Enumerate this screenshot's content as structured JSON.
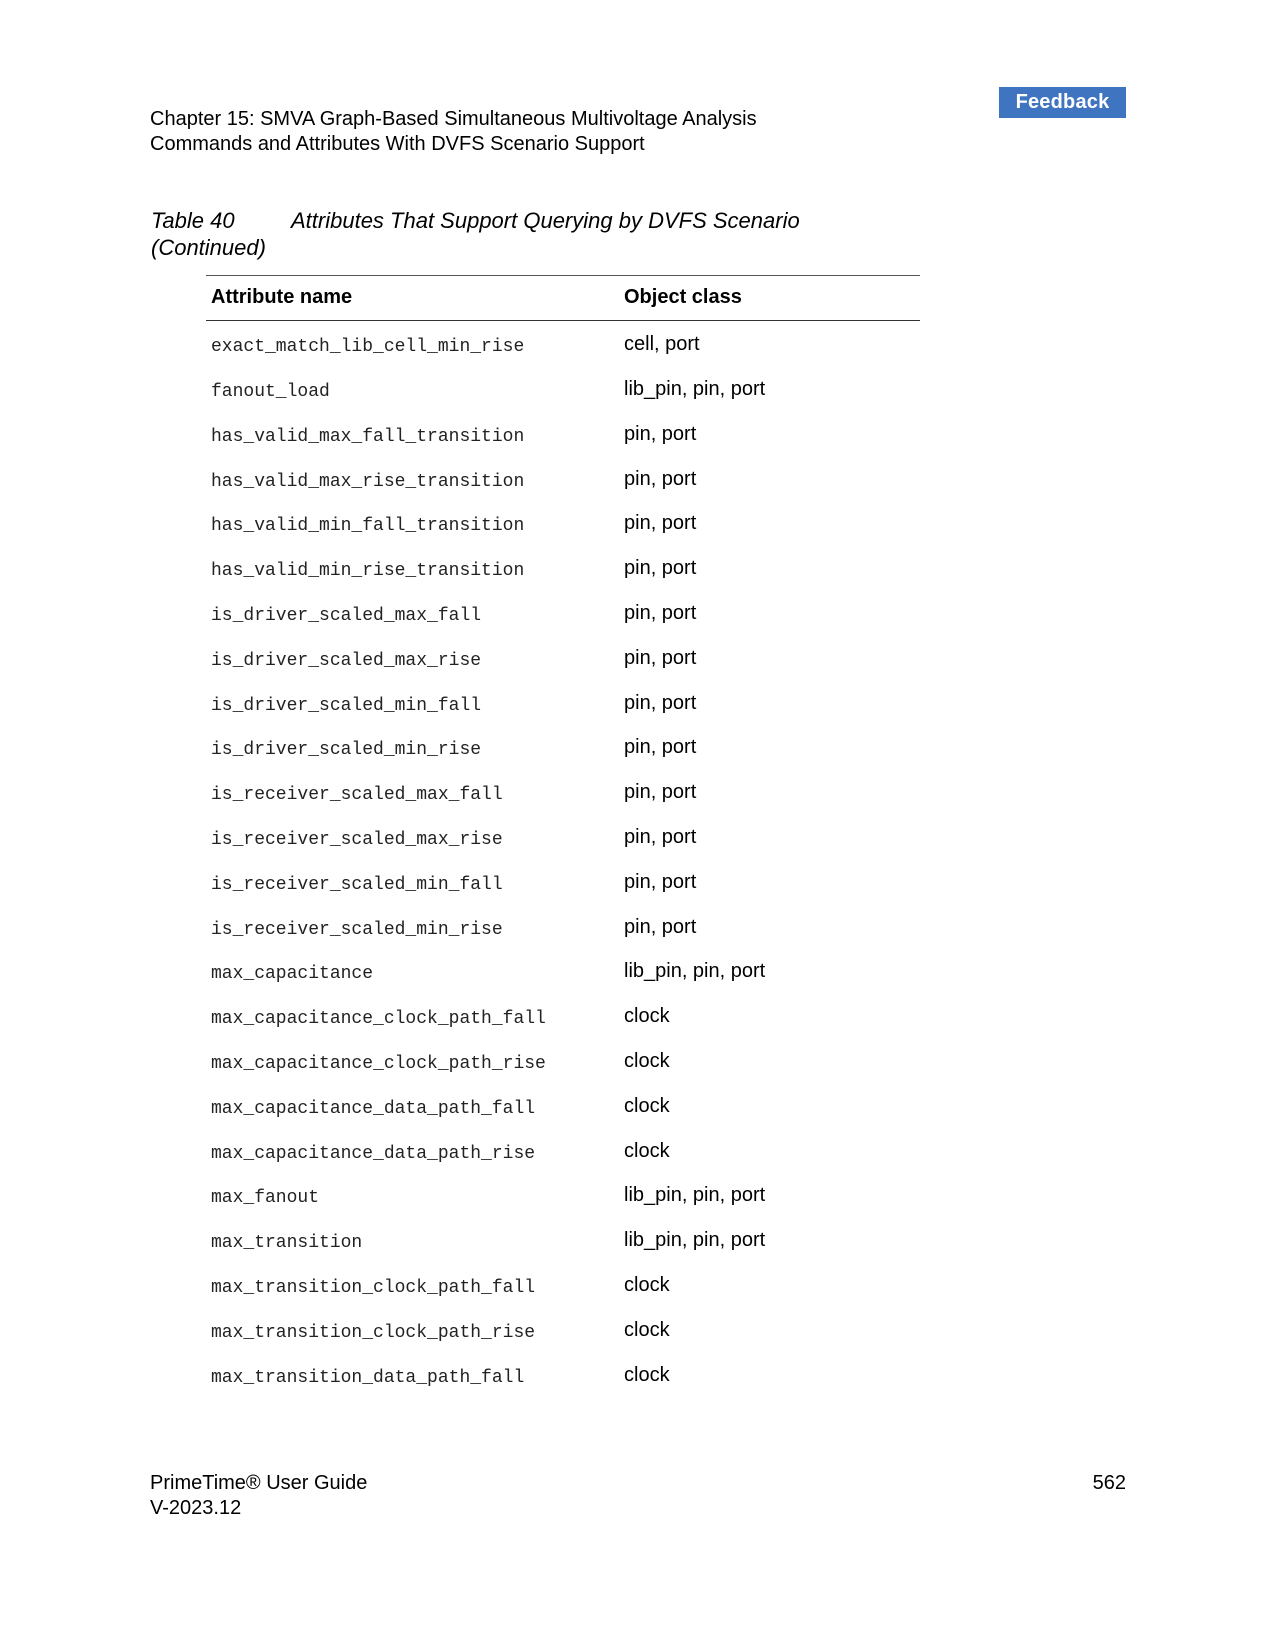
{
  "feedback_label": "Feedback",
  "header": {
    "line1": "Chapter 15: SMVA Graph-Based Simultaneous Multivoltage Analysis",
    "line2": "Commands and Attributes With DVFS Scenario Support"
  },
  "caption": {
    "number": "Table 40",
    "title": "Attributes That Support Querying by DVFS Scenario",
    "continued": "(Continued)"
  },
  "table": {
    "headers": [
      "Attribute name",
      "Object class"
    ],
    "rows": [
      {
        "attr": "exact_match_lib_cell_min_rise",
        "cls": "cell, port"
      },
      {
        "attr": "fanout_load",
        "cls": "lib_pin, pin, port"
      },
      {
        "attr": "has_valid_max_fall_transition",
        "cls": "pin, port"
      },
      {
        "attr": "has_valid_max_rise_transition",
        "cls": "pin, port"
      },
      {
        "attr": "has_valid_min_fall_transition",
        "cls": "pin, port"
      },
      {
        "attr": "has_valid_min_rise_transition",
        "cls": "pin, port"
      },
      {
        "attr": "is_driver_scaled_max_fall",
        "cls": "pin, port"
      },
      {
        "attr": "is_driver_scaled_max_rise",
        "cls": "pin, port"
      },
      {
        "attr": "is_driver_scaled_min_fall",
        "cls": "pin, port"
      },
      {
        "attr": "is_driver_scaled_min_rise",
        "cls": "pin, port"
      },
      {
        "attr": "is_receiver_scaled_max_fall",
        "cls": "pin, port"
      },
      {
        "attr": "is_receiver_scaled_max_rise",
        "cls": "pin, port"
      },
      {
        "attr": "is_receiver_scaled_min_fall",
        "cls": "pin, port"
      },
      {
        "attr": "is_receiver_scaled_min_rise",
        "cls": "pin, port"
      },
      {
        "attr": "max_capacitance",
        "cls": "lib_pin, pin, port"
      },
      {
        "attr": "max_capacitance_clock_path_fall",
        "cls": "clock"
      },
      {
        "attr": "max_capacitance_clock_path_rise",
        "cls": "clock"
      },
      {
        "attr": "max_capacitance_data_path_fall",
        "cls": "clock"
      },
      {
        "attr": "max_capacitance_data_path_rise",
        "cls": "clock"
      },
      {
        "attr": "max_fanout",
        "cls": "lib_pin, pin, port"
      },
      {
        "attr": "max_transition",
        "cls": "lib_pin, pin, port"
      },
      {
        "attr": "max_transition_clock_path_fall",
        "cls": "clock"
      },
      {
        "attr": "max_transition_clock_path_rise",
        "cls": "clock"
      },
      {
        "attr": "max_transition_data_path_fall",
        "cls": "clock"
      }
    ]
  },
  "footer": {
    "product": "PrimeTime® User Guide",
    "version": "V-2023.12",
    "page_number": "562"
  }
}
